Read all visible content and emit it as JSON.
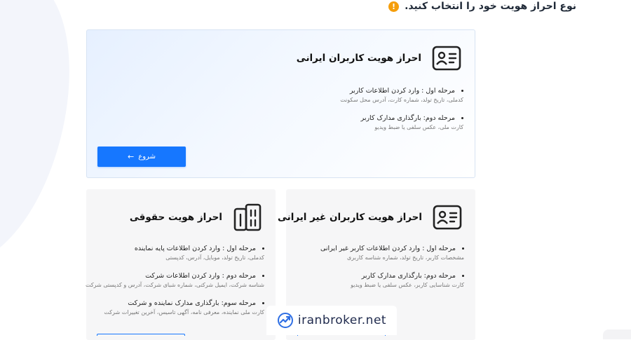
{
  "heading": {
    "text": "نوع احراز هویت خود را انتخاب کنید.",
    "info_icon": "info-icon"
  },
  "cards": {
    "iranian": {
      "title": "احراز هویت کاربران ایرانی",
      "icon": "id-card-icon",
      "steps": [
        {
          "title": "مرحله اول : وارد کردن اطلاعات کاربر",
          "desc": "کدملی، تاریخ تولد، شماره کارت، آدرس محل سکونت"
        },
        {
          "title": "مرحله دوم: بارگذاری مدارک کاربر",
          "desc": "کارت ملی، عکس سلفی یا ضبط ویدیو"
        }
      ],
      "button": "شروع"
    },
    "foreign": {
      "title": "احراز هویت کاربران غیر ایرانی",
      "icon": "id-card-icon",
      "steps": [
        {
          "title": "مرحله اول : وارد کردن اطلاعات کاربر غیر ایرانی",
          "desc": "مشخصات کاربر، تاریخ تولد، شماره شناسه کاربری"
        },
        {
          "title": "مرحله دوم: بارگذاری مدارک کاربر",
          "desc": "کارت شناسایی کاربر، عکس سلفی یا ضبط ویدیو"
        }
      ]
    },
    "legal": {
      "title": "احراز هویت حقوقی",
      "icon": "building-icon",
      "steps": [
        {
          "title": "مرحله اول : وارد کردن اطلاعات پایه نماینده",
          "desc": "کدملی، تاریخ تولد، موبایل، آدرس، کدپستی"
        },
        {
          "title": "مرحله دوم : وارد کردن اطلاعات شرکت",
          "desc": "شناسه شرکت، ایمیل شرکتی، شماره شبای شرکت، آدرس و کدپستی شرکت"
        },
        {
          "title": "مرحله سوم: بارگذاری مدارک نماینده و شرکت",
          "desc": "کارت ملی نماینده، معرفی نامه، آگهی تاسیس، آخرین تغییرات شرکت"
        }
      ]
    }
  },
  "watermark": {
    "text": "iranbroker.net",
    "logo": "trend-logo-icon"
  },
  "colors": {
    "accent": "#1677ff",
    "info": "#f59e0b",
    "card_grey": "#f6f6f7"
  }
}
